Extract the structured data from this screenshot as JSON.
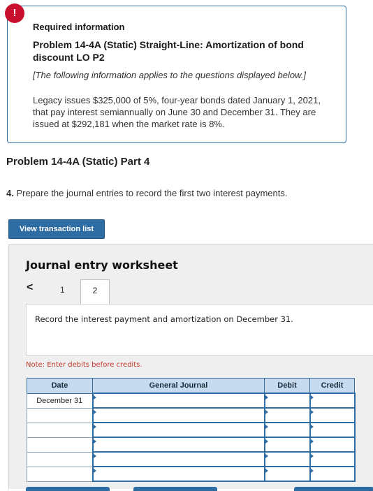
{
  "alert": {
    "icon": "exclamation-icon",
    "symbol": "!"
  },
  "info": {
    "required": "Required information",
    "title": "Problem 14-4A (Static) Straight-Line: Amortization of bond discount LO P2",
    "note": "[The following information applies to the questions displayed below.]",
    "body": "Legacy issues $325,000 of 5%, four-year bonds dated January 1, 2021, that pay interest semiannually on June 30 and December 31. They are issued at $292,181 when the market rate is 8%."
  },
  "part": {
    "title": "Problem 14-4A (Static) Part 4"
  },
  "question": {
    "number": "4.",
    "text": " Prepare the journal entries to record the first two interest payments."
  },
  "buttons": {
    "view_transactions": "View transaction list"
  },
  "worksheet": {
    "title": "Journal entry worksheet",
    "prev_icon": "chevron-left-icon",
    "prev_symbol": "<",
    "tabs": [
      "1",
      "2"
    ],
    "active_tab": "2",
    "instruction": "Record the interest payment and amortization on December 31.",
    "note": "Note: Enter debits before credits.",
    "columns": [
      "Date",
      "General Journal",
      "Debit",
      "Credit"
    ],
    "rows": [
      {
        "date": "December 31",
        "account": "",
        "debit": "",
        "credit": ""
      },
      {
        "date": "",
        "account": "",
        "debit": "",
        "credit": ""
      },
      {
        "date": "",
        "account": "",
        "debit": "",
        "credit": ""
      },
      {
        "date": "",
        "account": "",
        "debit": "",
        "credit": ""
      },
      {
        "date": "",
        "account": "",
        "debit": "",
        "credit": ""
      },
      {
        "date": "",
        "account": "",
        "debit": "",
        "credit": ""
      }
    ]
  },
  "colors": {
    "accent": "#2e6ca4",
    "header_bg": "#c6dbef",
    "alert": "#c8102e",
    "note": "#c0392b"
  }
}
